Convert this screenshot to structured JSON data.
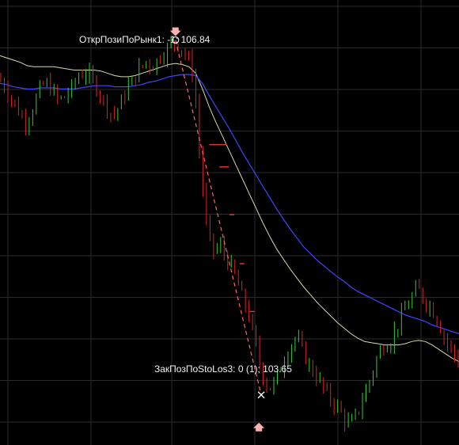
{
  "colors": {
    "background": "#000000",
    "grid": "#2b2b2b",
    "bull_candle": "#33cc33",
    "bear_candle": "#dd2222",
    "ma_slow": "#4444ff",
    "ma_fast": "#d8d8b0",
    "trade_line": "#ff6666",
    "stop_marks": "#e03030",
    "arrow": "#ffb0b0",
    "text": "#f2f2f2"
  },
  "chart_data": {
    "type": "line",
    "title": "",
    "xlabel": "",
    "ylabel": "",
    "ylim": [
      103.2,
      107.2
    ],
    "grid": true,
    "series": [
      {
        "kind": "price",
        "values": [
          106.5,
          106.44,
          106.32,
          106.22,
          106.1,
          106.18,
          106.36,
          106.46,
          106.4,
          106.3,
          106.33,
          106.41,
          106.52,
          106.55,
          106.48,
          106.38,
          106.26,
          106.16,
          106.24,
          106.38,
          106.48,
          106.58,
          106.65,
          106.6,
          106.7,
          106.75,
          106.83,
          106.78,
          106.68,
          106.52,
          105.7,
          105.1,
          104.94,
          104.98,
          104.86,
          104.74,
          104.55,
          104.4,
          104.12,
          103.86,
          103.7,
          103.76,
          103.93,
          104.07,
          104.16,
          104.06,
          103.91,
          103.83,
          103.72,
          103.62,
          103.56,
          103.46,
          103.37,
          103.47,
          103.63,
          103.79,
          103.98,
          104.1,
          104.13,
          104.27,
          104.4,
          104.51,
          104.61,
          104.5,
          104.44,
          104.32,
          104.16,
          104.06,
          103.96
        ]
      },
      {
        "kind": "moving-average-slow",
        "values": [
          106.45,
          106.44,
          106.42,
          106.41,
          106.4,
          106.4,
          106.41,
          106.41,
          106.41,
          106.4,
          106.4,
          106.4,
          106.41,
          106.42,
          106.43,
          106.43,
          106.43,
          106.42,
          106.42,
          106.42,
          106.43,
          106.44,
          106.46,
          106.47,
          106.49,
          106.51,
          106.52,
          106.53,
          106.53,
          106.52,
          106.45,
          106.34,
          106.24,
          106.14,
          106.04,
          105.93,
          105.82,
          105.72,
          105.62,
          105.52,
          105.42,
          105.32,
          105.23,
          105.14,
          105.06,
          104.98,
          104.92,
          104.86,
          104.81,
          104.76,
          104.71,
          104.67,
          104.62,
          104.58,
          104.55,
          104.52,
          104.49,
          104.46,
          104.43,
          104.4,
          104.37,
          104.35,
          104.33,
          104.31,
          104.28,
          104.26,
          104.24,
          104.22,
          104.2
        ]
      },
      {
        "kind": "moving-average-fast",
        "values": [
          106.7,
          106.68,
          106.66,
          106.64,
          106.61,
          106.6,
          106.6,
          106.6,
          106.6,
          106.59,
          106.58,
          106.57,
          106.57,
          106.57,
          106.57,
          106.56,
          106.54,
          106.52,
          106.51,
          106.51,
          106.52,
          106.54,
          106.56,
          106.58,
          106.6,
          106.62,
          106.63,
          106.62,
          106.6,
          106.54,
          106.4,
          106.24,
          106.1,
          105.97,
          105.84,
          105.71,
          105.58,
          105.45,
          105.32,
          105.19,
          105.07,
          104.96,
          104.87,
          104.78,
          104.7,
          104.62,
          104.55,
          104.48,
          104.42,
          104.36,
          104.3,
          104.25,
          104.2,
          104.16,
          104.13,
          104.12,
          104.11,
          104.1,
          104.1,
          104.1,
          104.11,
          104.13,
          104.14,
          104.13,
          104.1,
          104.06,
          104.02,
          103.98,
          103.95
        ]
      }
    ],
    "trades": [
      {
        "label": "ОткрПозиПоРынк1: -1; 106.84",
        "price": 106.84
      },
      {
        "label": "ЗакПозПоStoLos3: 0 (1); 103.65",
        "price": 103.65
      }
    ],
    "stop_levels": [
      105.9,
      105.7,
      105.27,
      104.83,
      104.4
    ]
  }
}
